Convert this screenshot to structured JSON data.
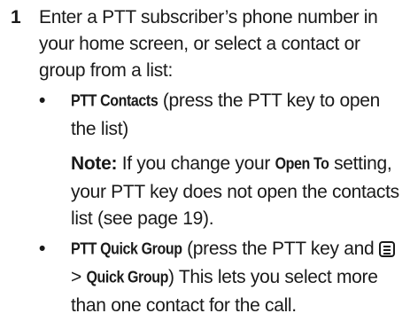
{
  "step": {
    "number": "1",
    "text": "Enter a PTT subscriber’s phone number in your home screen, or select a contact or group from a list:"
  },
  "bullet_symbol": "•",
  "bullets": [
    {
      "term": "PTT Contacts",
      "text": " (press the PTT key to open the list)"
    },
    {
      "term": "PTT Quick Group",
      "text_before": " (press the PTT key and ",
      "icon": "menu-key-icon",
      "separator": " > ",
      "term2": "Quick Group",
      "text_after": ") This lets you select more than one contact for the call."
    }
  ],
  "note": {
    "label": "Note:",
    "text_before": " If you change your ",
    "term": "Open To",
    "text_after": " setting, your PTT key does not open the contacts list (see page 19)."
  }
}
